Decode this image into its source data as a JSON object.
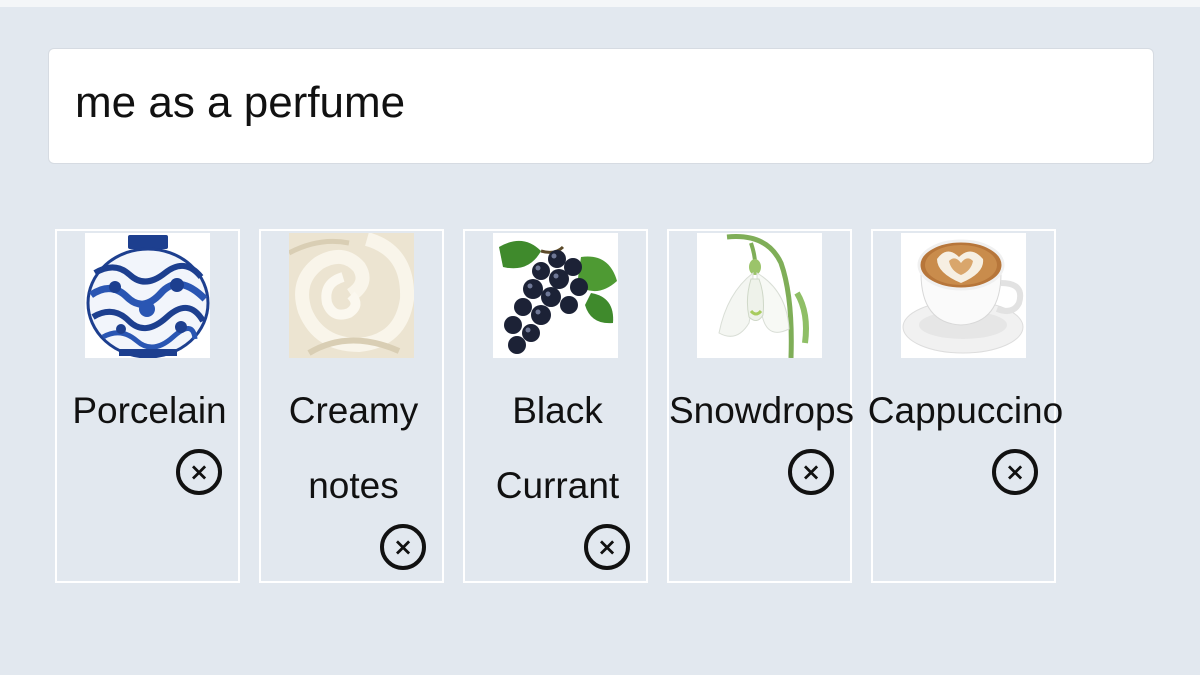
{
  "search": {
    "value": "me as a perfume"
  },
  "notes": [
    {
      "label_line1": "Porcelain",
      "label_line2": "",
      "image": "porcelain-vase",
      "remove_icon": "×"
    },
    {
      "label_line1": "Creamy",
      "label_line2": "notes",
      "image": "cream-swirl",
      "remove_icon": "×"
    },
    {
      "label_line1": "Black",
      "label_line2": "Currant",
      "image": "blackcurrant-berries",
      "remove_icon": "×"
    },
    {
      "label_line1": "Snowdrops",
      "label_line2": "",
      "image": "snowdrop-flower",
      "remove_icon": "×"
    },
    {
      "label_line1": "Cappuccino",
      "label_line2": "",
      "image": "cappuccino-cup",
      "remove_icon": "×"
    }
  ],
  "colors": {
    "background": "#e2e8ef",
    "card_border": "#ffffff",
    "text": "#111111"
  }
}
